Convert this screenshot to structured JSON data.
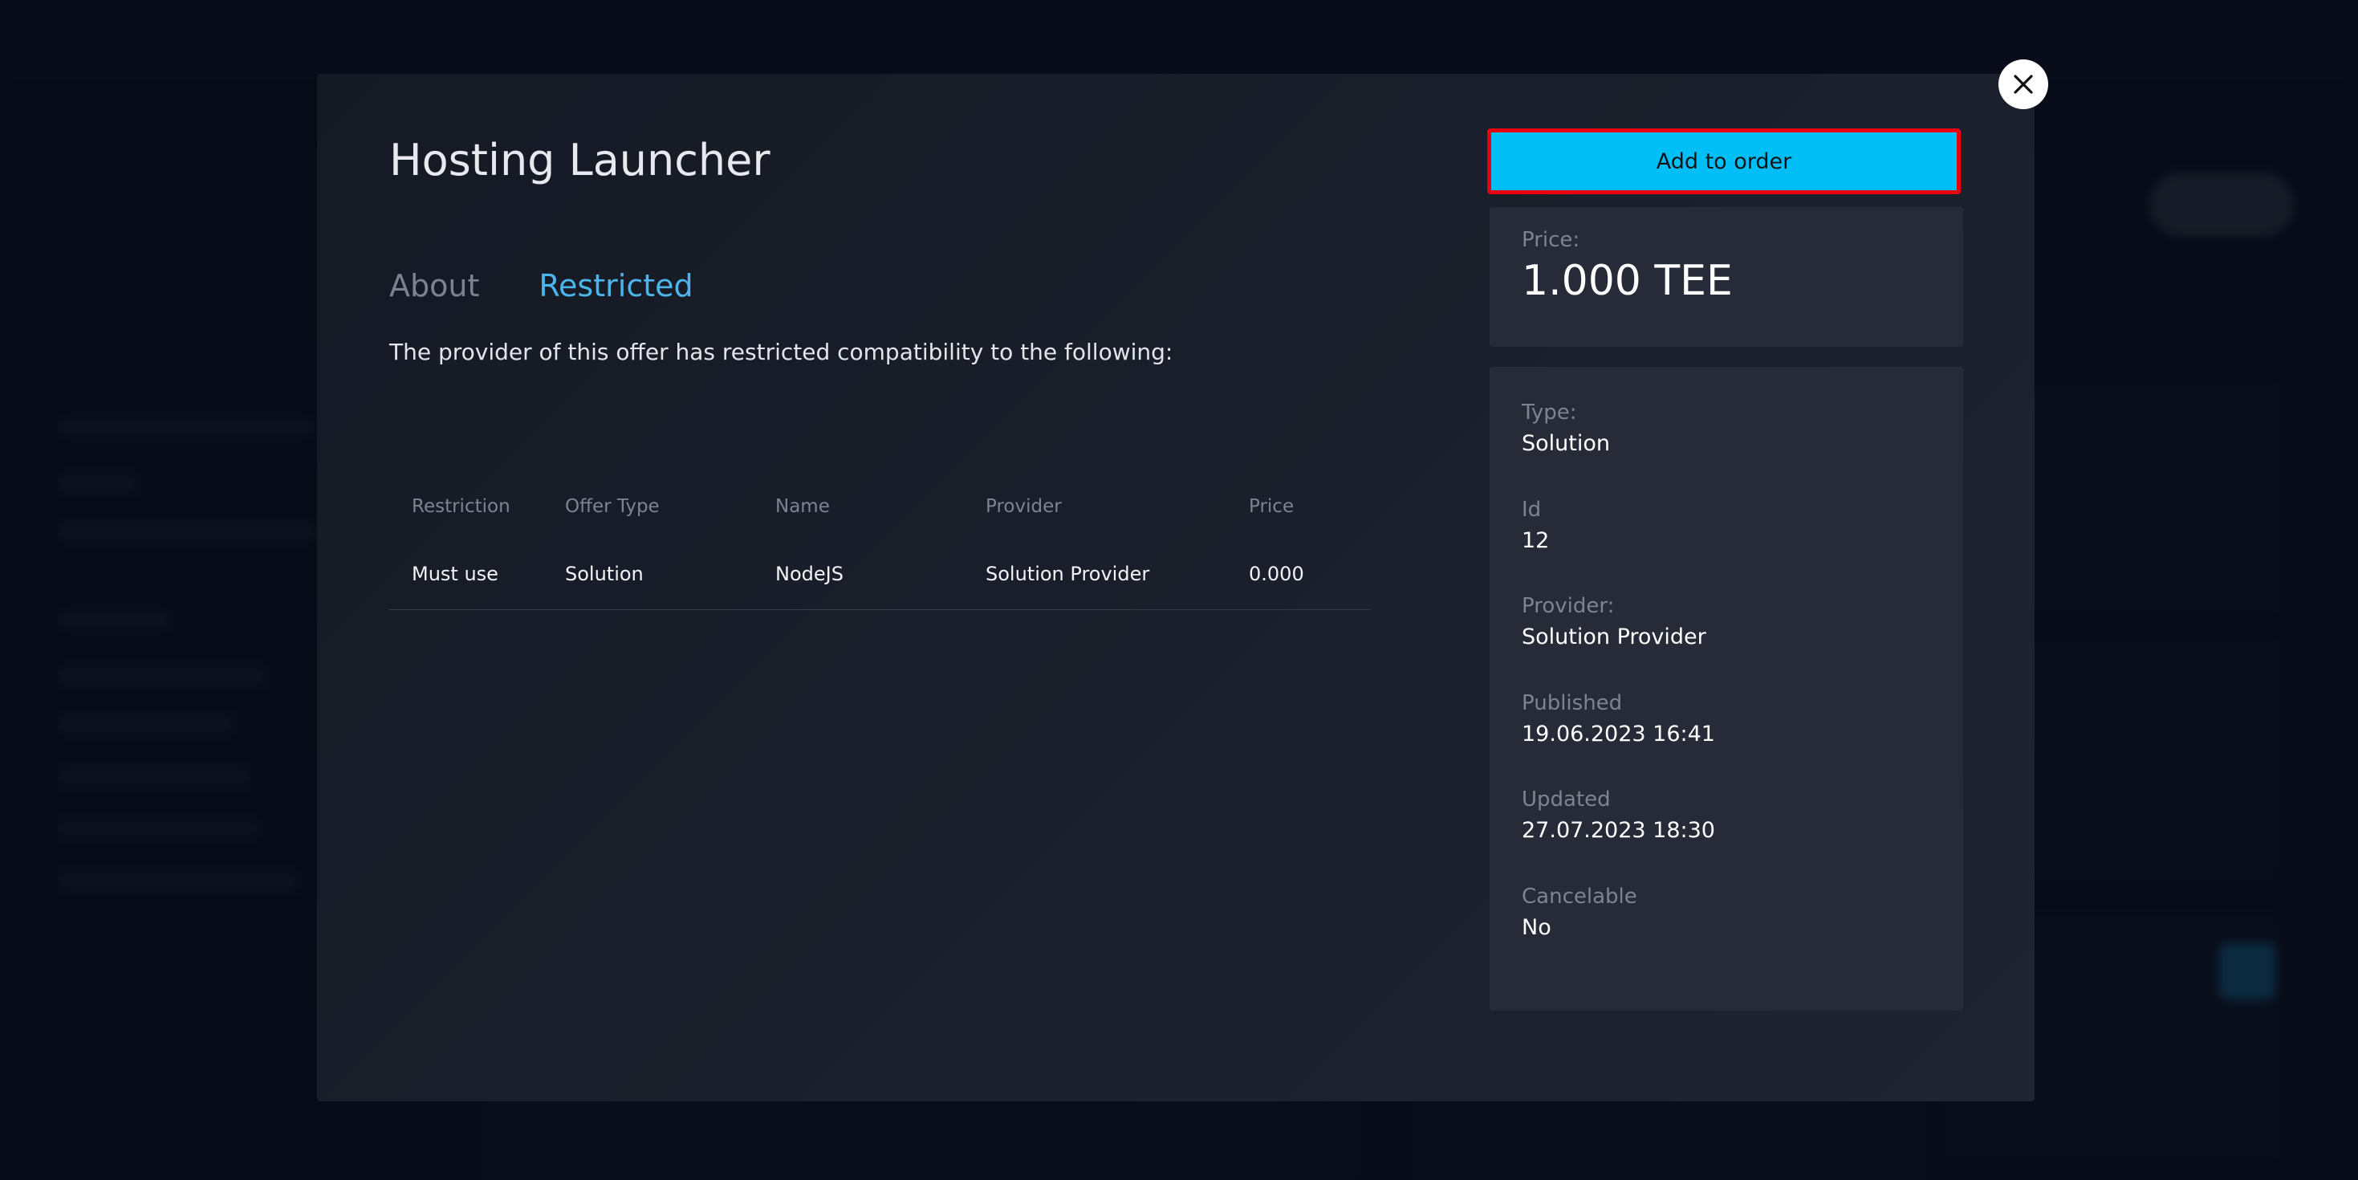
{
  "modal": {
    "title": "Hosting Launcher",
    "close_icon": "close-icon",
    "tabs": [
      {
        "label": "About",
        "active": false
      },
      {
        "label": "Restricted",
        "active": true
      }
    ],
    "intro_text": "The provider of this offer has restricted compatibility to the following:",
    "table": {
      "columns": [
        "Restriction",
        "Offer Type",
        "Name",
        "Provider",
        "Price"
      ],
      "rows": [
        {
          "restriction": "Must use",
          "offer_type": "Solution",
          "name": "NodeJS",
          "provider": "Solution Provider",
          "price": "0.000"
        }
      ]
    },
    "add_button_label": "Add to order",
    "price": {
      "label": "Price:",
      "value": "1.000 TEE"
    },
    "details": [
      {
        "label": "Type:",
        "value": "Solution"
      },
      {
        "label": "Id",
        "value": "12"
      },
      {
        "label": "Provider:",
        "value": "Solution Provider"
      },
      {
        "label": "Published",
        "value": "19.06.2023 16:41"
      },
      {
        "label": "Updated",
        "value": "27.07.2023 18:30"
      },
      {
        "label": "Cancelable",
        "value": "No"
      }
    ]
  },
  "colors": {
    "accent": "#00bff6",
    "active_tab": "#4ab6ea",
    "highlight_border": "#e8000f",
    "modal_bg": "#1b202c",
    "panel_bg": "#262b37"
  }
}
